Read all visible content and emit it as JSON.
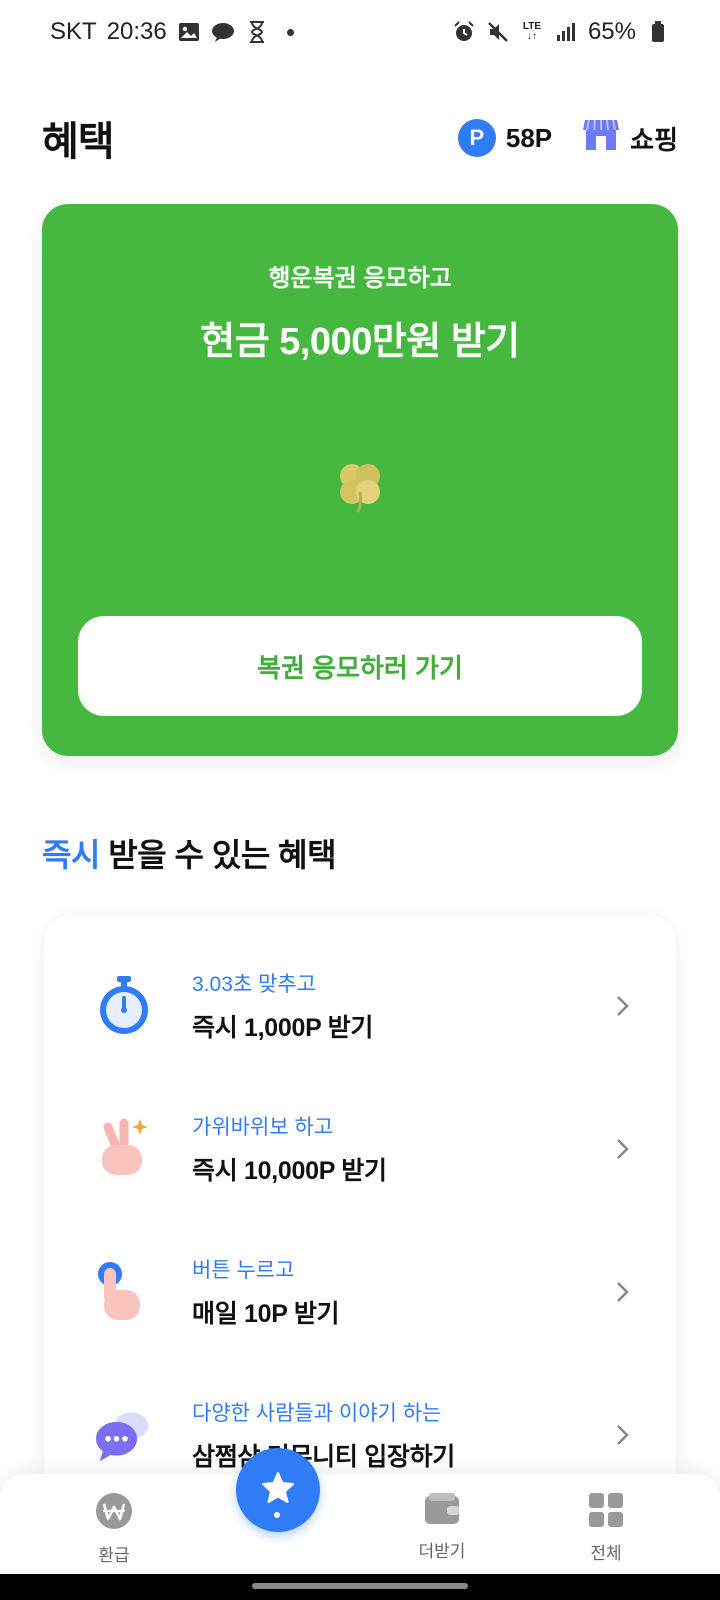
{
  "status_bar": {
    "carrier": "SKT",
    "time": "20:36",
    "network": "LTE",
    "battery": "65%",
    "icons_left": [
      "gallery-icon",
      "chat-bubble-icon",
      "hourglass-icon",
      "dot-icon"
    ],
    "icons_right": [
      "alarm-icon",
      "mute-icon",
      "lte-icon",
      "signal-icon",
      "battery-icon"
    ]
  },
  "header": {
    "title": "혜택",
    "points_symbol": "P",
    "points": "58P",
    "shop_label": "쇼핑"
  },
  "lottery": {
    "subtitle": "행운복권 응모하고",
    "title": "현금 5,000만원 받기",
    "button_label": "복권 응모하러 가기",
    "icon": "clover-icon"
  },
  "section": {
    "accent": "즉시",
    "rest": " 받을 수 있는 혜택"
  },
  "benefits": [
    {
      "caption": "3.03초 맞추고",
      "title": "즉시 1,000P 받기",
      "icon": "stopwatch-icon"
    },
    {
      "caption": "가위바위보 하고",
      "title": "즉시 10,000P 받기",
      "icon": "hand-gesture-icon"
    },
    {
      "caption": "버튼 누르고",
      "title": "매일 10P 받기",
      "icon": "finger-press-icon"
    },
    {
      "caption": "다양한 사람들과 이야기 하는",
      "title": "삼쩜삼 커뮤니티 입장하기",
      "icon": "chat-icon"
    }
  ],
  "bottom_nav": {
    "items": [
      {
        "label": "환급",
        "icon": "won-icon"
      },
      {
        "label": "",
        "icon": "star-icon"
      },
      {
        "label": "더받기",
        "icon": "wallet-icon"
      },
      {
        "label": "전체",
        "icon": "grid-icon"
      }
    ]
  },
  "colors": {
    "accent_blue": "#2f7cf6",
    "card_green": "#46b83f",
    "button_text_green": "#3fae3a"
  }
}
